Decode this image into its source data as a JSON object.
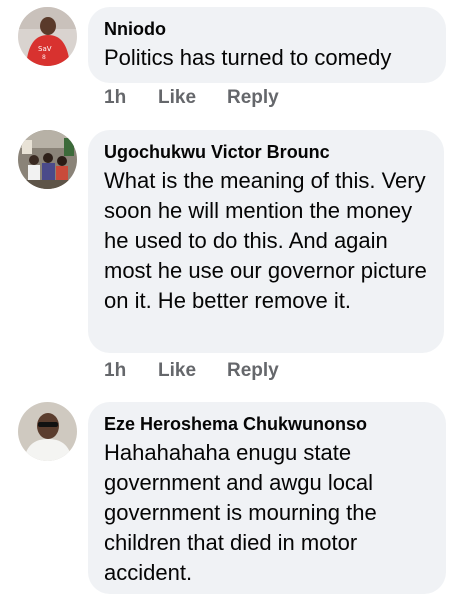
{
  "comments": [
    {
      "author": "Nniodo",
      "text": "Politics has turned to comedy",
      "time": "1h",
      "like_label": "Like",
      "reply_label": "Reply",
      "avatar_icon": "profile-photo-red-jersey"
    },
    {
      "author": "Ugochukwu Victor Brounc",
      "text": "What is the meaning of this. Very soon he will mention the money he used to do this. And again most he use our governor picture on it. He better remove it.",
      "time": "1h",
      "like_label": "Like",
      "reply_label": "Reply",
      "avatar_icon": "profile-photo-crowd"
    },
    {
      "author": "Eze Heroshema Chukwunonso",
      "text": "Hahahahaha enugu state government and awgu local government is mourning the children that died in motor accident.",
      "avatar_icon": "profile-photo-man-sunglasses"
    }
  ],
  "colors": {
    "bubble": "#f0f2f5",
    "text": "#050505",
    "meta": "#65676b"
  }
}
